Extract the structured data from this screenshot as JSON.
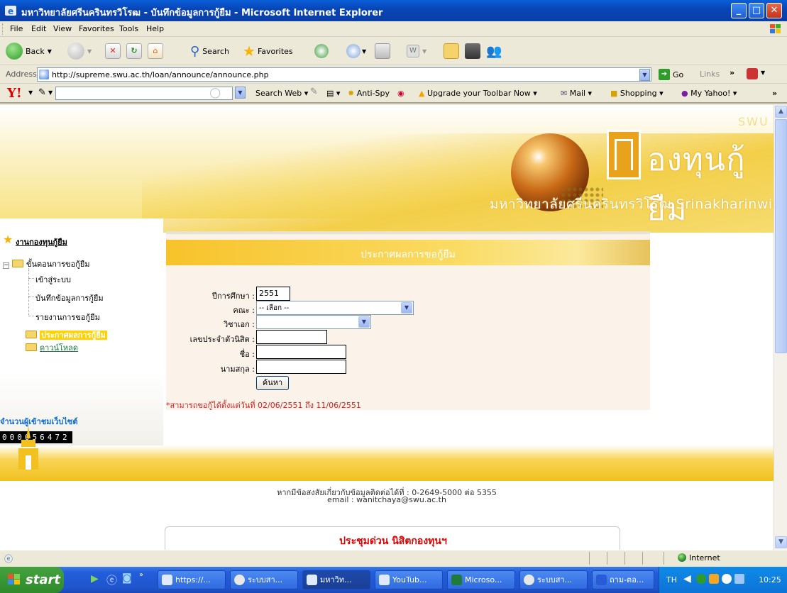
{
  "window": {
    "title": "มหาวิทยาลัยศรีนครินทรวิโรฒ - บันทึกข้อมูลการกู้ยืม - Microsoft Internet Explorer"
  },
  "menu": [
    "File",
    "Edit",
    "View",
    "Favorites",
    "Tools",
    "Help"
  ],
  "toolbar": {
    "back": "Back",
    "search": "Search",
    "favorites": "Favorites"
  },
  "address": {
    "label": "Address",
    "url": "http://supreme.swu.ac.th/loan/announce/announce.php",
    "go": "Go",
    "links": "Links"
  },
  "yahoo": {
    "logo": "Y!",
    "search_web": "Search Web",
    "anti_spy": "Anti-Spy",
    "upgrade": "Upgrade your Toolbar Now",
    "mail": "Mail",
    "shopping": "Shopping",
    "my_yahoo": "My Yahoo!"
  },
  "banner": {
    "logo_text": "องทุนกู้ยืม",
    "swu": "SWU",
    "university": "มหาวิทยาลัยศรีนครินทรวิโรฒ Srinakharinwirot University"
  },
  "nav": {
    "heading": "งานกองทุนกู้ยืม",
    "group": "ขั้นตอนการขอกู้ยืม",
    "items": [
      "เข้าสู่ระบบ",
      "บันทึกข้อมูลการกู้ยืม",
      "รายงานการขอกู้ยืม"
    ],
    "announce": "ประกาศผลการกู้ยืม",
    "download": "ดาวน์โหลด",
    "visitors_label": "จำนวนผู้เข้าชมเว็บไซต์",
    "visitors_count": "000056472"
  },
  "form": {
    "title": "ประกาศผลการขอกู้ยืม",
    "year_label": "ปีการศึกษา :",
    "year_value": "2551",
    "faculty_label": "คณะ :",
    "faculty_value": "-- เลือก --",
    "major_label": "วิชาเอก :",
    "major_value": "",
    "student_id_label": "เลขประจำตัวนิสิต :",
    "name_label": "ชื่อ :",
    "surname_label": "นามสกุล :",
    "search_button": "ค้นหา",
    "note": "*สามารถขอกู้ได้ตั้งแต่วันที่ 02/06/2551 ถึง 11/06/2551"
  },
  "footer": {
    "contact_line1": "หากมีข้อสงสัยเกี่ยวกับข้อมูลติดต่อได้ที่ : 0-2649-5000 ต่อ 5355",
    "contact_line2": "email : wanitchaya@swu.ac.th",
    "news_title": "ประชุมด่วน นิสิตกองทุนฯ"
  },
  "status": {
    "zone": "Internet"
  },
  "taskbar": {
    "start": "start",
    "buttons": [
      "https://...",
      "ระบบสา...",
      "มหาวิท...",
      "YouTub...",
      "Microso...",
      "ระบบสา...",
      "ถาม-ตอ..."
    ],
    "lang": "TH",
    "clock": "10:25"
  }
}
